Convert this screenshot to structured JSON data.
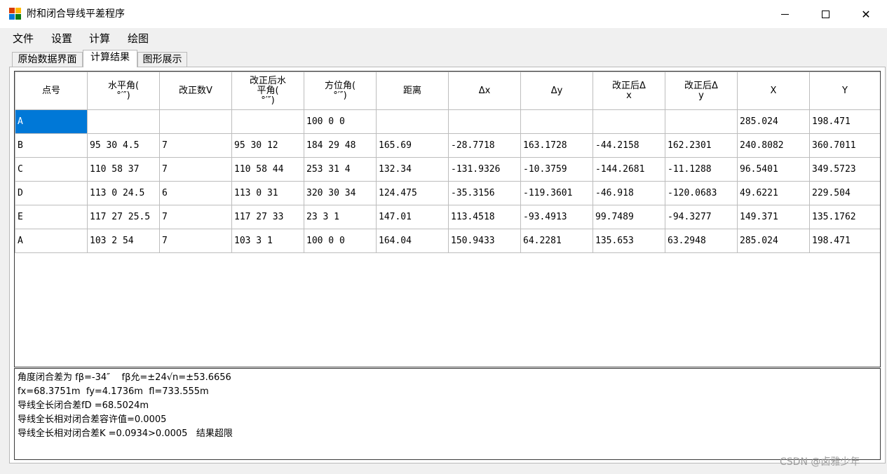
{
  "window": {
    "title": "附和闭合导线平差程序",
    "icon": "app-icon",
    "minimize_icon": "minimize-icon",
    "maximize_icon": "maximize-icon",
    "close_symbol": "✕"
  },
  "menu": {
    "items": [
      "文件",
      "设置",
      "计算",
      "绘图"
    ]
  },
  "tabs": [
    {
      "label": "原始数据界面",
      "active": false
    },
    {
      "label": "计算结果",
      "active": true
    },
    {
      "label": "图形展示",
      "active": false
    }
  ],
  "grid": {
    "headers": [
      "点号",
      "水平角(\n°′″)",
      "改正数V",
      "改正后水\n平角(\n°′″)",
      "方位角(\n°′″)",
      "距离",
      "Δx",
      "Δy",
      "改正后Δ\nx",
      "改正后Δ\ny",
      "X",
      "Y"
    ],
    "rows": [
      [
        "A",
        "",
        "",
        "",
        "100 0 0",
        "",
        "",
        "",
        "",
        "",
        "285.024",
        "198.471"
      ],
      [
        "B",
        "95 30 4.5",
        "7",
        "95 30 12",
        "184 29 48",
        "165.69",
        "-28.7718",
        "163.1728",
        "-44.2158",
        "162.2301",
        "240.8082",
        "360.7011"
      ],
      [
        "C",
        "110 58 37",
        "7",
        "110 58 44",
        "253 31 4",
        "132.34",
        "-131.9326",
        "-10.3759",
        "-144.2681",
        "-11.1288",
        "96.5401",
        "349.5723"
      ],
      [
        "D",
        "113 0 24.5",
        "6",
        "113 0 31",
        "320 30 34",
        "124.475",
        "-35.3156",
        "-119.3601",
        "-46.918",
        "-120.0683",
        "49.6221",
        "229.504"
      ],
      [
        "E",
        "117 27 25.5",
        "7",
        "117 27 33",
        "23 3 1",
        "147.01",
        "113.4518",
        "-93.4913",
        "99.7489",
        "-94.3277",
        "149.371",
        "135.1762"
      ],
      [
        "A",
        "103 2 54",
        "7",
        "103 3 1",
        "100 0 0",
        "164.04",
        "150.9433",
        "64.2281",
        "135.653",
        "63.2948",
        "285.024",
        "198.471"
      ]
    ],
    "selected_color": "#0078d7"
  },
  "results": {
    "lines": [
      "角度闭合差为 fβ=-34″    fβ允=±24√n=±53.6656",
      "fx=68.3751m  fy=4.1736m  fl=733.555m",
      "导线全长闭合差fD =68.5024m",
      "导线全长相对闭合差容许值=0.0005",
      "导线全长相对闭合差K =0.0934>0.0005   结果超限"
    ]
  },
  "watermark": "CSDN @卤雅少年"
}
